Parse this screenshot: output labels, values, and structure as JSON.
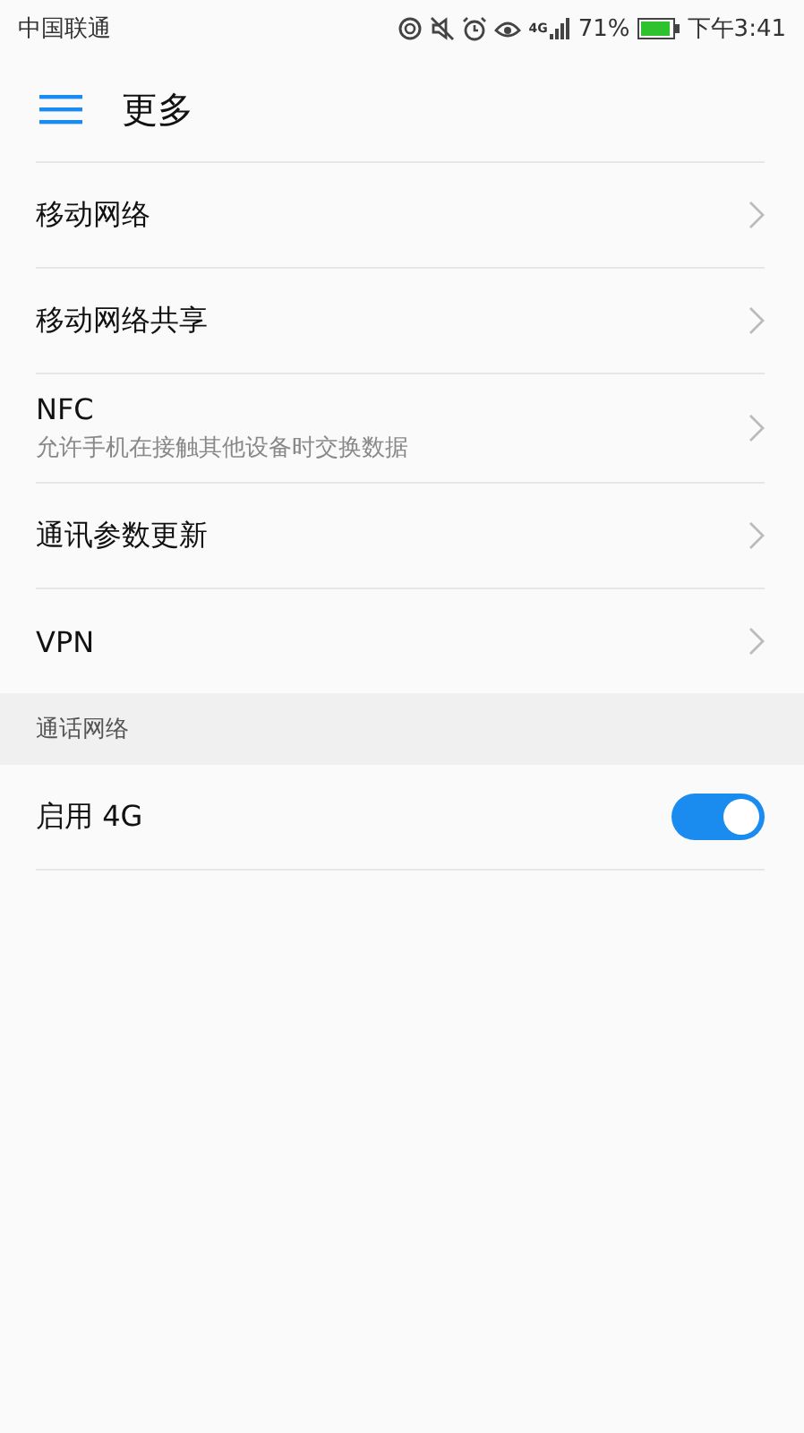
{
  "status_bar": {
    "carrier": "中国联通",
    "network": "4G",
    "battery": "71%",
    "time": "下午3:41"
  },
  "header": {
    "title": "更多"
  },
  "items": [
    {
      "kind": "nav",
      "title": "移动网络"
    },
    {
      "kind": "nav",
      "title": "移动网络共享"
    },
    {
      "kind": "nav",
      "title": "NFC",
      "subtitle": "允许手机在接触其他设备时交换数据"
    },
    {
      "kind": "nav",
      "title": "通讯参数更新"
    },
    {
      "kind": "nav",
      "title": "VPN"
    }
  ],
  "sections": [
    {
      "title": "通话网络",
      "items": [
        {
          "kind": "toggle",
          "title": "启用 4G",
          "on": true
        }
      ]
    }
  ]
}
